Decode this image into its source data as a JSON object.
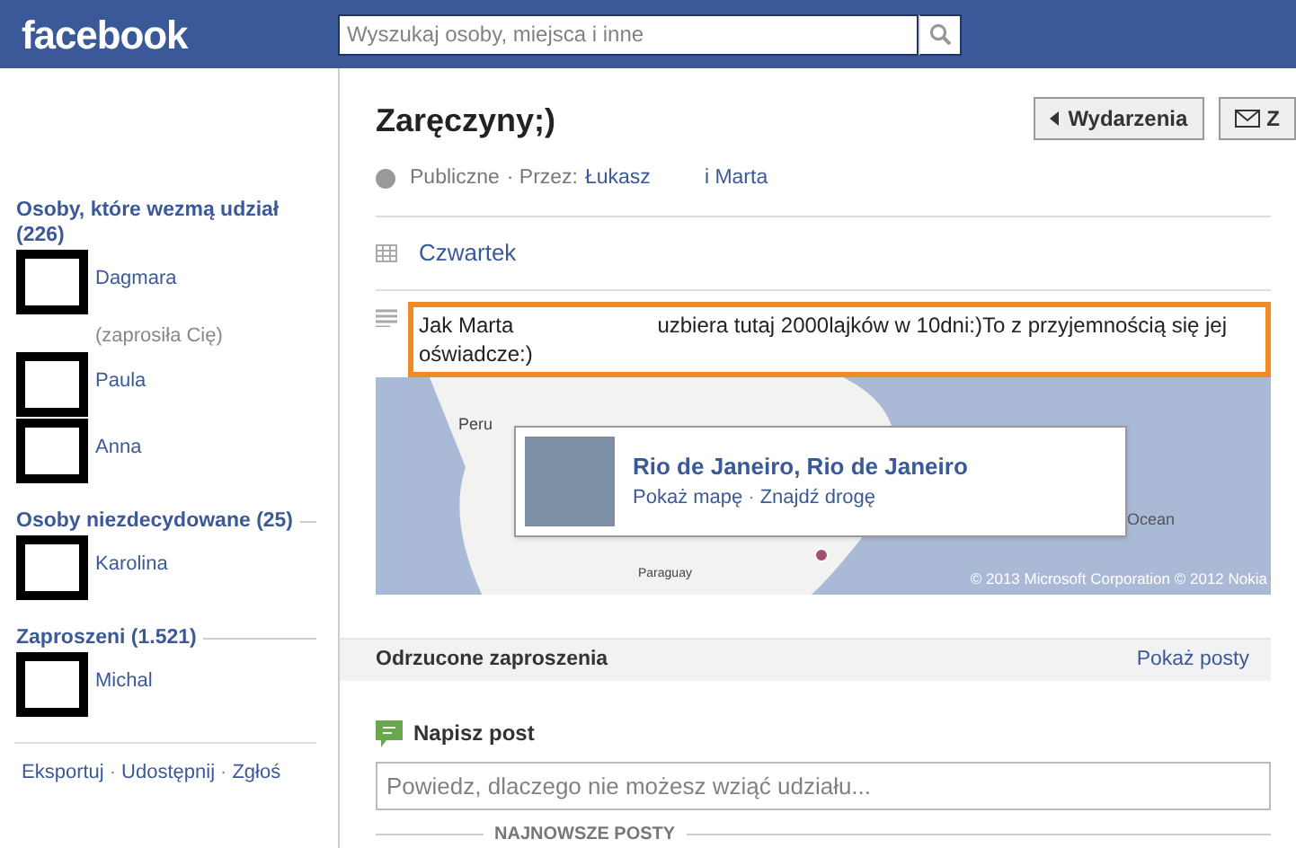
{
  "header": {
    "logo": "facebook",
    "search": {
      "placeholder": "Wyszukaj osoby, miejsca i inne"
    }
  },
  "sidebar": {
    "sections": [
      {
        "title": "Osoby, które wezmą udział (226)",
        "people": [
          {
            "name": "Dagmara",
            "note": "(zaprosiła Cię)"
          },
          {
            "name": "Paula"
          },
          {
            "name": "Anna"
          }
        ]
      },
      {
        "title": "Osoby niezdecydowane (25)",
        "people": [
          {
            "name": "Karolina"
          }
        ]
      },
      {
        "title": "Zaproszeni (1.521)",
        "people": [
          {
            "name": "Michal"
          }
        ]
      }
    ],
    "footer_links": [
      "Eksportuj",
      "Udostępnij",
      "Zgłoś"
    ],
    "separator": "·"
  },
  "event": {
    "title": "Zaręczyny;)",
    "privacy": "Publiczne",
    "by_label": "· Przez:",
    "hosts": [
      "Łukasz",
      "i Marta"
    ],
    "buttons": [
      {
        "label": "Wydarzenia",
        "kind": "back"
      },
      {
        "label": "Z",
        "kind": "message"
      }
    ],
    "date": "Czwartek",
    "description": "Jak Marta                        uzbiera tutaj 2000lajków w 10dni:)To z przyjemnością się jej oświadcze:)",
    "map": {
      "labels": [
        "Peru",
        "Paraguay",
        "Ocean"
      ],
      "copyright": "© 2013 Microsoft Corporation © 2012 Nokia",
      "place": {
        "name": "Rio de Janeiro, Rio de Janeiro",
        "links": [
          "Pokaż mapę",
          "Znajdź drogę"
        ],
        "separator": "·"
      }
    }
  },
  "declined": {
    "title": "Odrzucone zaproszenia",
    "link": "Pokaż posty"
  },
  "composer": {
    "title": "Napisz post",
    "placeholder": "Powiedz, dlaczego nie możesz wziąć udziału..."
  },
  "posts_divider": "NAJNOWSZE POSTY"
}
